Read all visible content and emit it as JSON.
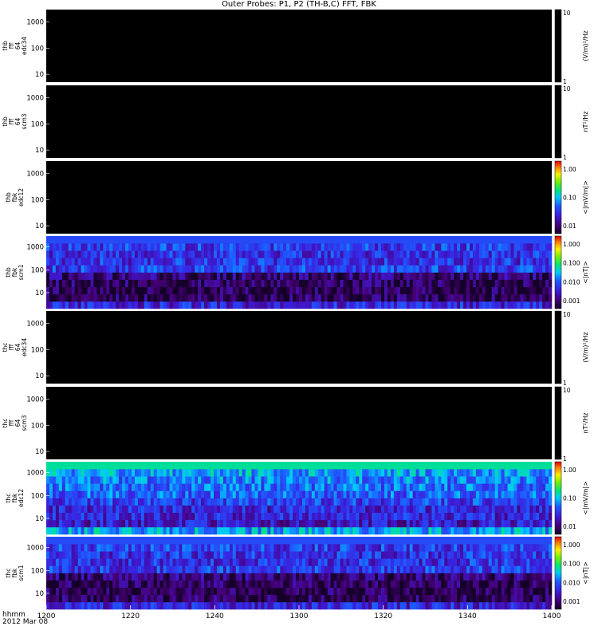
{
  "title": "Outer Probes: P1, P2 (TH-B,C) FFT, FBK",
  "footer": {
    "hhmm": "hhmm",
    "date": "2012 Mar 08"
  },
  "chart_data": [
    {
      "type": "heatmap",
      "ylabel": [
        "thb",
        "fff",
        "64",
        "edc34"
      ],
      "yscale": "log",
      "yticks": [
        "10",
        "100",
        "1000"
      ],
      "yrange": [
        5,
        3000
      ],
      "colorbar": {
        "label": "(V/m)²/Hz",
        "ticks": [
          "10",
          "1"
        ],
        "style": "black-white"
      },
      "fill": "empty",
      "x": [
        "1200",
        "1220",
        "1240",
        "1300",
        "1320",
        "1340",
        "1400"
      ],
      "z": []
    },
    {
      "type": "heatmap",
      "ylabel": [
        "thb",
        "fff",
        "64",
        "scm3"
      ],
      "yscale": "log",
      "yticks": [
        "10",
        "100",
        "1000"
      ],
      "yrange": [
        5,
        3000
      ],
      "colorbar": {
        "label": "nT²/Hz",
        "ticks": [
          "10",
          "1"
        ],
        "style": "black-white"
      },
      "fill": "empty",
      "x": [
        "1200",
        "1220",
        "1240",
        "1300",
        "1320",
        "1340",
        "1400"
      ],
      "z": []
    },
    {
      "type": "heatmap",
      "ylabel": [
        "thb",
        "fbk",
        "edc12"
      ],
      "yscale": "log",
      "yticks": [
        "10",
        "100",
        "1000"
      ],
      "yrange": [
        5,
        3000
      ],
      "colorbar": {
        "label": "<|mV/m|>",
        "ticks": [
          "1.00",
          "0.10",
          "0.01"
        ],
        "style": "rainbow"
      },
      "fill": "empty",
      "x": [
        "1200",
        "1220",
        "1240",
        "1300",
        "1320",
        "1340",
        "1400"
      ],
      "z": []
    },
    {
      "type": "heatmap",
      "ylabel": [
        "thb",
        "fbk",
        "scm1"
      ],
      "yscale": "log",
      "yticks": [
        "10",
        "100",
        "1000"
      ],
      "yrange": [
        2,
        3000
      ],
      "colorbar": {
        "label": "<|nT|>",
        "ticks": [
          "1.000",
          "0.100",
          "0.010",
          "0.001"
        ],
        "style": "rainbow"
      },
      "fill": "filled",
      "x": [
        "1200",
        "1220",
        "1240",
        "1300",
        "1320",
        "1340",
        "1400"
      ],
      "z": [
        0.004,
        0.0009,
        0.0008,
        0.0009,
        0.0012,
        0.006,
        0.005,
        0.005,
        0.006,
        0.008
      ]
    },
    {
      "type": "heatmap",
      "ylabel": [
        "thc",
        "fff",
        "64",
        "edc34"
      ],
      "yscale": "log",
      "yticks": [
        "10",
        "100",
        "1000"
      ],
      "yrange": [
        5,
        3000
      ],
      "colorbar": {
        "label": "(V/m)²/Hz",
        "ticks": [
          "10",
          "1"
        ],
        "style": "black-white"
      },
      "fill": "empty",
      "x": [
        "1200",
        "1220",
        "1240",
        "1300",
        "1320",
        "1340",
        "1400"
      ],
      "z": []
    },
    {
      "type": "heatmap",
      "ylabel": [
        "thc",
        "fff",
        "64",
        "scm3"
      ],
      "yscale": "log",
      "yticks": [
        "10",
        "100",
        "1000"
      ],
      "yrange": [
        5,
        3000
      ],
      "colorbar": {
        "label": "nT²/Hz",
        "ticks": [
          "10",
          "1"
        ],
        "style": "black-white"
      },
      "fill": "empty",
      "x": [
        "1200",
        "1220",
        "1240",
        "1300",
        "1320",
        "1340",
        "1400"
      ],
      "z": []
    },
    {
      "type": "heatmap",
      "ylabel": [
        "thc",
        "fbk",
        "edc12"
      ],
      "yscale": "log",
      "yticks": [
        "10",
        "100",
        "1000"
      ],
      "yrange": [
        2,
        3000
      ],
      "colorbar": {
        "label": "<|mV/m|>",
        "ticks": [
          "1.00",
          "0.10",
          "0.01"
        ],
        "style": "rainbow"
      },
      "fill": "filled",
      "x": [
        "1200",
        "1220",
        "1240",
        "1300",
        "1320",
        "1340",
        "1400"
      ],
      "z": [
        0.02,
        0.003,
        0.004,
        0.004,
        0.006,
        0.01,
        0.012,
        0.014,
        0.02,
        0.05
      ]
    },
    {
      "type": "heatmap",
      "ylabel": [
        "thc",
        "fbk",
        "scm1"
      ],
      "yscale": "log",
      "yticks": [
        "10",
        "100",
        "1000"
      ],
      "yrange": [
        2,
        3000
      ],
      "colorbar": {
        "label": "<|nT|>",
        "ticks": [
          "1.000",
          "0.100",
          "0.010",
          "0.001"
        ],
        "style": "rainbow"
      },
      "fill": "filled",
      "x": [
        "1200",
        "1220",
        "1240",
        "1300",
        "1320",
        "1340",
        "1400"
      ],
      "z": [
        0.004,
        0.0009,
        0.0008,
        0.0009,
        0.0012,
        0.006,
        0.005,
        0.005,
        0.006,
        0.008
      ]
    }
  ]
}
